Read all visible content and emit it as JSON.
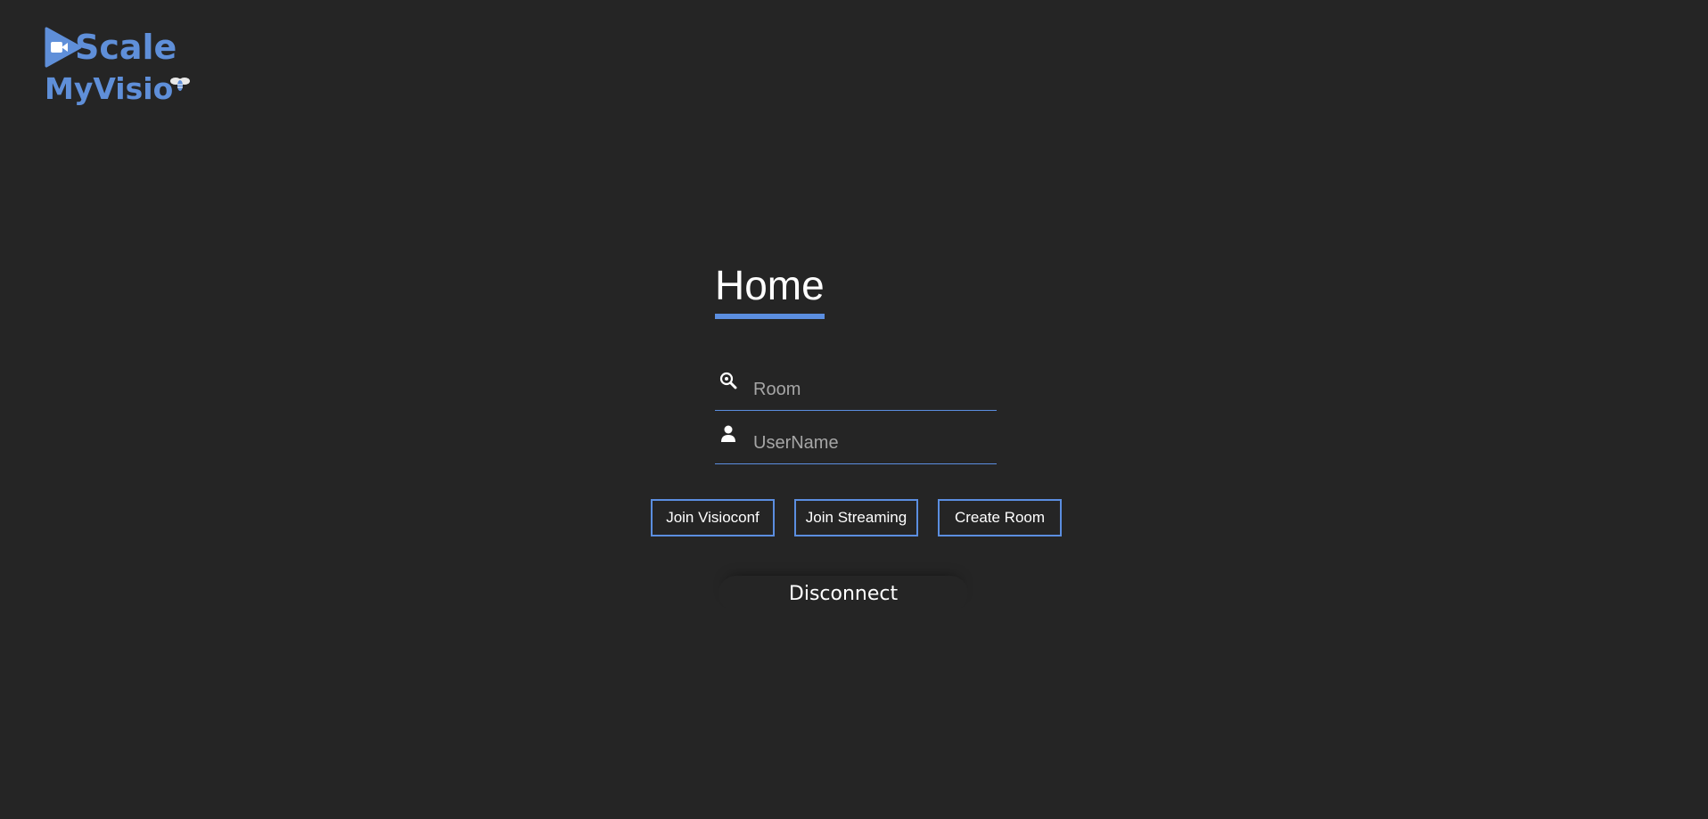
{
  "logo": {
    "line1": "Scale",
    "line2": "MyVisio",
    "brand_color": "#5f8fd9",
    "icons": [
      "video-play-icon",
      "bee-icon"
    ]
  },
  "form": {
    "title": "Home",
    "room_placeholder": "Room",
    "room_value": "",
    "room_icon": "search-icon",
    "username_placeholder": "UserName",
    "username_value": "",
    "username_icon": "user-icon"
  },
  "buttons": {
    "join_visioconf": "Join Visioconf",
    "join_streaming": "Join Streaming",
    "create_room": "Create Room"
  },
  "disconnect_label": "Disconnect",
  "colors": {
    "background": "#252525",
    "accent": "#5b8ee0",
    "text": "#ffffff",
    "placeholder": "#a6a6a6"
  }
}
